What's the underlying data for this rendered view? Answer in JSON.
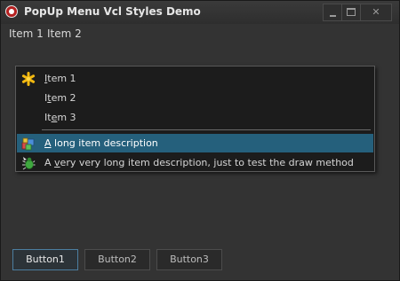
{
  "window": {
    "title": "PopUp Menu Vcl Styles Demo",
    "controls": {
      "minimize": "minimize",
      "maximize": "maximize",
      "close": "✕"
    }
  },
  "menubar": {
    "items": [
      {
        "label": "Item 1"
      },
      {
        "label": "Item 2"
      }
    ]
  },
  "popup_menu": {
    "items": [
      {
        "label": "Item 1",
        "icon": "asterisk-icon",
        "accelerator": "I"
      },
      {
        "label": "Item 2",
        "icon": "",
        "accelerator": "t"
      },
      {
        "label": "Item 3",
        "icon": "",
        "accelerator": "e"
      },
      {
        "label": "A long item description",
        "icon": "blocks-icon",
        "accelerator": "A",
        "highlighted": true
      },
      {
        "label": "A very very long item description, just to test the draw method",
        "icon": "bug-icon",
        "accelerator": "v"
      }
    ]
  },
  "buttons": [
    {
      "label": "Button1",
      "focused": true
    },
    {
      "label": "Button2",
      "focused": false
    },
    {
      "label": "Button3",
      "focused": false
    }
  ],
  "colors": {
    "background": "#2b2b2b",
    "menu_background": "#1c1c1c",
    "highlight": "#25607c",
    "title_icon": "#b52020"
  }
}
